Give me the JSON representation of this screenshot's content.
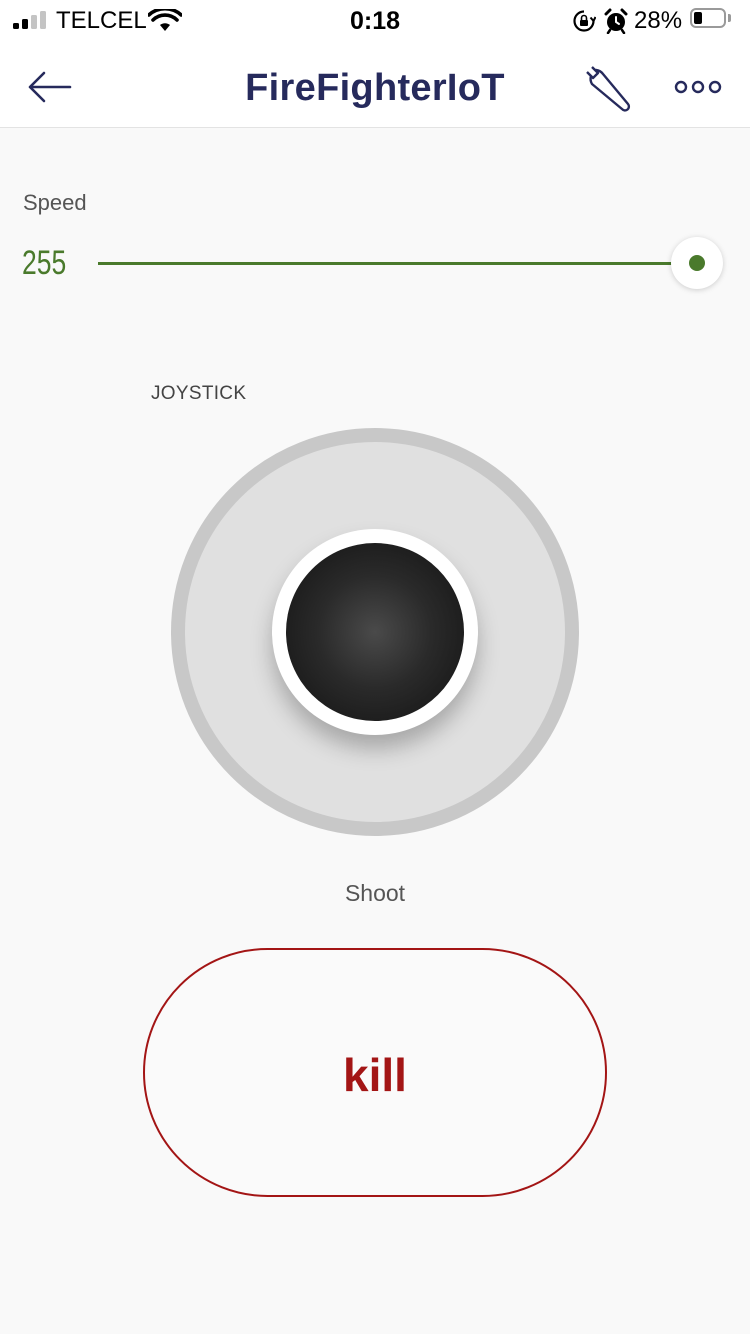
{
  "status_bar": {
    "carrier": "TELCEL",
    "time": "0:18",
    "battery_percent": "28%",
    "signal_bars_active": 2,
    "signal_bars_total": 4
  },
  "header": {
    "title": "FireFighterIoT",
    "back_icon": "arrow-left-icon",
    "settings_icon": "wrench-icon",
    "more_icon": "more-dots-icon",
    "title_color": "#262a5c"
  },
  "speed": {
    "label": "Speed",
    "value": "255",
    "level_fraction": 1.0,
    "accent_color": "#4a7a2c"
  },
  "joystick": {
    "label": "JOYSTICK"
  },
  "shoot": {
    "label": "Shoot",
    "button_label": "kill",
    "accent_color": "#a31515"
  }
}
